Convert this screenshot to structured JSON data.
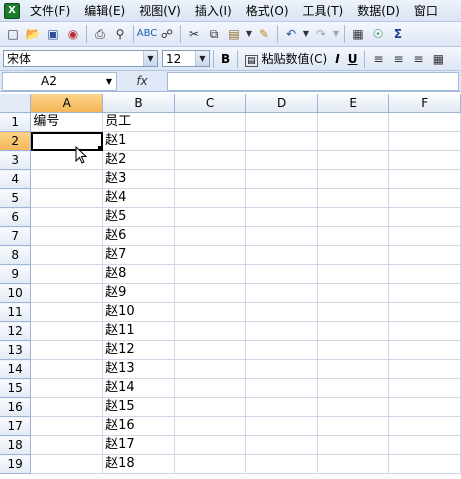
{
  "menu": {
    "items": [
      "文件(F)",
      "编辑(E)",
      "视图(V)",
      "插入(I)",
      "格式(O)",
      "工具(T)",
      "数据(D)",
      "窗口"
    ]
  },
  "toolbar": {
    "icons": [
      "new-icon",
      "open-icon",
      "save-icon",
      "permission-icon",
      "print-icon",
      "print-preview-icon",
      "spelling-icon",
      "research-icon",
      "cut-icon",
      "copy-icon",
      "paste-icon",
      "format-painter-icon",
      "undo-icon",
      "redo-icon",
      "chart-icon",
      "hyperlink-icon",
      "autosum-icon"
    ]
  },
  "format_bar": {
    "font_name": "宋体",
    "font_size": "12",
    "bold_label": "B",
    "paste_values_label": "粘贴数值(C)",
    "italic_label": "I",
    "underline_label": "U"
  },
  "formula_bar": {
    "name_box": "A2",
    "fx_label": "fx",
    "content": ""
  },
  "sheet": {
    "columns": [
      "A",
      "B",
      "C",
      "D",
      "E",
      "F"
    ],
    "rows": [
      {
        "num": "1",
        "a": "编号",
        "b": "员工"
      },
      {
        "num": "2",
        "a": "",
        "b": "赵1"
      },
      {
        "num": "3",
        "a": "",
        "b": "赵2"
      },
      {
        "num": "4",
        "a": "",
        "b": "赵3"
      },
      {
        "num": "5",
        "a": "",
        "b": "赵4"
      },
      {
        "num": "6",
        "a": "",
        "b": "赵5"
      },
      {
        "num": "7",
        "a": "",
        "b": "赵6"
      },
      {
        "num": "8",
        "a": "",
        "b": "赵7"
      },
      {
        "num": "9",
        "a": "",
        "b": "赵8"
      },
      {
        "num": "10",
        "a": "",
        "b": "赵9"
      },
      {
        "num": "11",
        "a": "",
        "b": "赵10"
      },
      {
        "num": "12",
        "a": "",
        "b": "赵11"
      },
      {
        "num": "13",
        "a": "",
        "b": "赵12"
      },
      {
        "num": "14",
        "a": "",
        "b": "赵13"
      },
      {
        "num": "15",
        "a": "",
        "b": "赵14"
      },
      {
        "num": "16",
        "a": "",
        "b": "赵15"
      },
      {
        "num": "17",
        "a": "",
        "b": "赵16"
      },
      {
        "num": "18",
        "a": "",
        "b": "赵17"
      },
      {
        "num": "19",
        "a": "",
        "b": "赵18"
      }
    ]
  }
}
